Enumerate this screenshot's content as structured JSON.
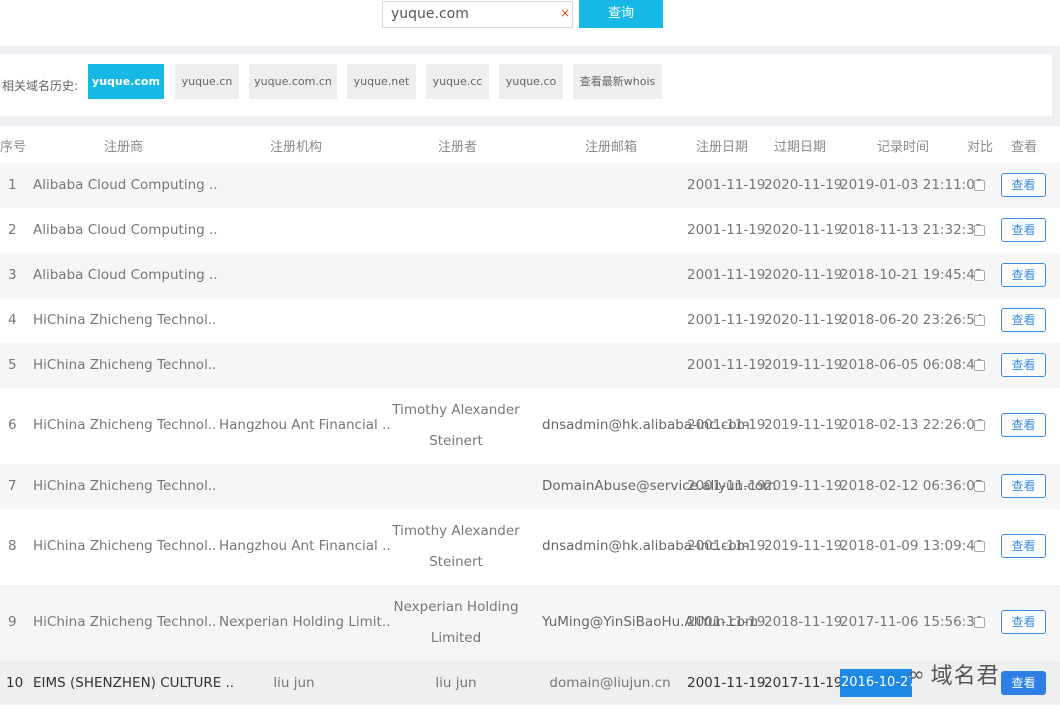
{
  "search": {
    "value": "yuque.com",
    "clear_glyph": "×",
    "button_label": "查询"
  },
  "history": {
    "label": "相关域名历史:",
    "chips": [
      "yuque.com",
      "yuque.cn",
      "yuque.com.cn",
      "yuque.net",
      "yuque.cc",
      "yuque.co",
      "查看最新whois"
    ],
    "active_index": 0
  },
  "table": {
    "headers": {
      "index": "序号",
      "registrar": "注册商",
      "org": "注册机构",
      "registrant": "注册者",
      "email": "注册邮箱",
      "reg_date": "注册日期",
      "exp_date": "过期日期",
      "record_time": "记录时间",
      "compare": "对比",
      "view": "查看"
    },
    "view_label": "查看",
    "rows": [
      {
        "index": "1",
        "registrar": "Alibaba Cloud Computing ..",
        "org": "",
        "registrant_1": "",
        "registrant_2": "",
        "email": "",
        "reg_date": "2001-11-19",
        "exp_date": "2020-11-19",
        "record_time": "2019-01-03 21:11:08"
      },
      {
        "index": "2",
        "registrar": "Alibaba Cloud Computing ..",
        "org": "",
        "registrant_1": "",
        "registrant_2": "",
        "email": "",
        "reg_date": "2001-11-19",
        "exp_date": "2020-11-19",
        "record_time": "2018-11-13 21:32:32"
      },
      {
        "index": "3",
        "registrar": "Alibaba Cloud Computing ..",
        "org": "",
        "registrant_1": "",
        "registrant_2": "",
        "email": "",
        "reg_date": "2001-11-19",
        "exp_date": "2020-11-19",
        "record_time": "2018-10-21 19:45:42"
      },
      {
        "index": "4",
        "registrar": "HiChina Zhicheng Technol..",
        "org": "",
        "registrant_1": "",
        "registrant_2": "",
        "email": "",
        "reg_date": "2001-11-19",
        "exp_date": "2020-11-19",
        "record_time": "2018-06-20 23:26:54"
      },
      {
        "index": "5",
        "registrar": "HiChina Zhicheng Technol..",
        "org": "",
        "registrant_1": "",
        "registrant_2": "",
        "email": "",
        "reg_date": "2001-11-19",
        "exp_date": "2019-11-19",
        "record_time": "2018-06-05 06:08:40"
      },
      {
        "index": "6",
        "registrar": "HiChina Zhicheng Technol..",
        "org": "Hangzhou Ant Financial ..",
        "registrant_1": "Timothy Alexander",
        "registrant_2": "Steinert",
        "email": "dnsadmin@hk.alibaba-inc.com",
        "reg_date": "2001-11-19",
        "exp_date": "2019-11-19",
        "record_time": "2018-02-13 22:26:06"
      },
      {
        "index": "7",
        "registrar": "HiChina Zhicheng Technol..",
        "org": "",
        "registrant_1": "",
        "registrant_2": "",
        "email": "DomainAbuse@service.aliyun.com",
        "reg_date": "2001-11-19",
        "exp_date": "2019-11-19",
        "record_time": "2018-02-12 06:36:05"
      },
      {
        "index": "8",
        "registrar": "HiChina Zhicheng Technol..",
        "org": "Hangzhou Ant Financial ..",
        "registrant_1": "Timothy Alexander",
        "registrant_2": "Steinert",
        "email": "dnsadmin@hk.alibaba-inc.com",
        "reg_date": "2001-11-19",
        "exp_date": "2019-11-19",
        "record_time": "2018-01-09 13:09:48"
      },
      {
        "index": "9",
        "registrar": "HiChina Zhicheng Technol..",
        "org": "Nexperian Holding Limit..",
        "registrant_1": "Nexperian Holding",
        "registrant_2": "Limited",
        "email": "YuMing@YinSiBaoHu.AliYun.com",
        "reg_date": "2001-11-19",
        "exp_date": "2018-11-19",
        "record_time": "2017-11-06 15:56:30"
      },
      {
        "index": "10",
        "registrar": "EIMS (SHENZHEN) CULTURE ..",
        "org": "liu jun",
        "registrant_1": "liu jun",
        "registrant_2": "",
        "email": "domain@liujun.cn",
        "reg_date": "2001-11-19",
        "exp_date": "2017-11-19",
        "record_time": "2016-10-27"
      }
    ]
  },
  "watermark": {
    "logo_glyph": "∞",
    "text": "域名君"
  },
  "colors": {
    "accent": "#16b9e6",
    "link": "#3b8be0",
    "highlight": "#1e88e5"
  }
}
